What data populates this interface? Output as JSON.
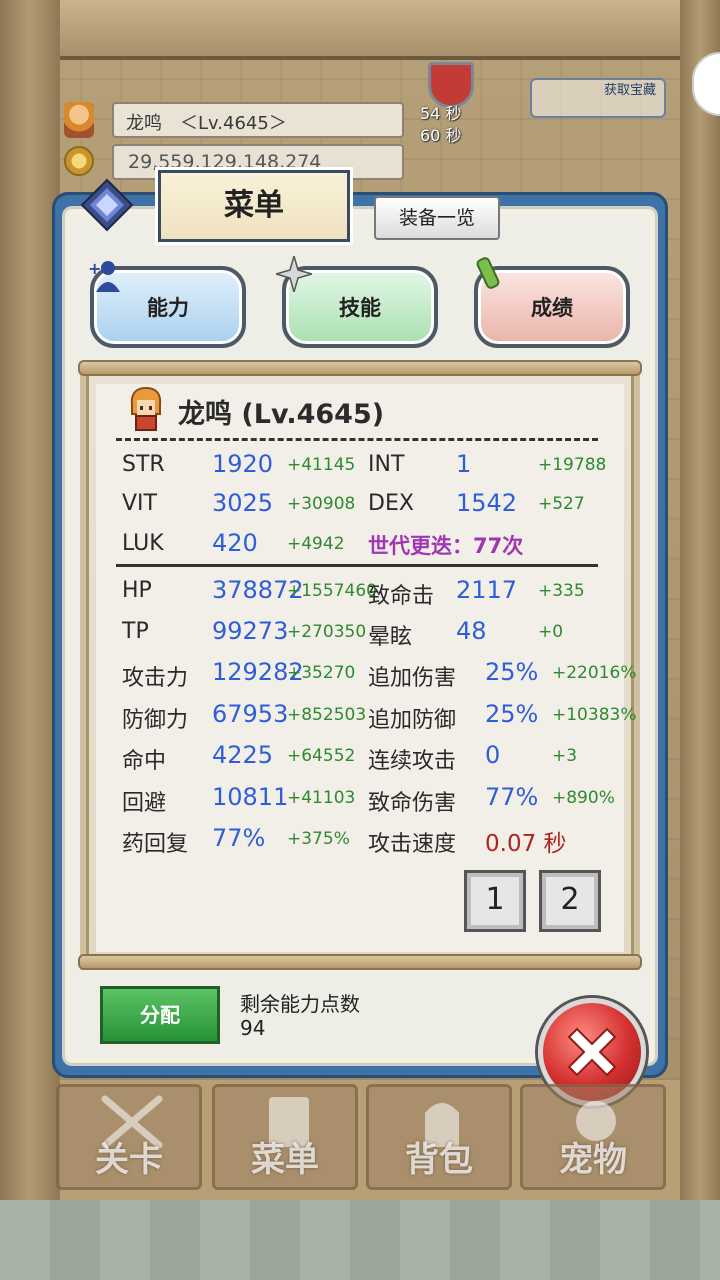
{
  "hud": {
    "player_label": "龙鸣　＜Lv.4645＞",
    "gold": "29,559,129,148,274",
    "timer1": "54 秒",
    "timer2": "60 秒",
    "bonus_label": "获取宝藏"
  },
  "menu": {
    "title": "菜单",
    "equip_list": "装备一览",
    "tabs": [
      "能力",
      "技能",
      "成绩"
    ]
  },
  "character": {
    "name": "龙鸣 (Lv.4645)"
  },
  "base_stats": [
    {
      "label": "STR",
      "value": "1920",
      "bonus": "+41145"
    },
    {
      "label": "INT",
      "value": "1",
      "bonus": "+19788"
    },
    {
      "label": "VIT",
      "value": "3025",
      "bonus": "+30908"
    },
    {
      "label": "DEX",
      "value": "1542",
      "bonus": "+527"
    },
    {
      "label": "LUK",
      "value": "420",
      "bonus": "+4942"
    }
  ],
  "generation": "世代更迭：77次",
  "combat_left": [
    {
      "label": "HP",
      "value": "378872",
      "bonus": "+1557460"
    },
    {
      "label": "TP",
      "value": "99273",
      "bonus": "+270350"
    },
    {
      "label": "攻击力",
      "value": "129282",
      "bonus": "+35270"
    },
    {
      "label": "防御力",
      "value": "67953",
      "bonus": "+852503"
    },
    {
      "label": "命中",
      "value": "4225",
      "bonus": "+64552"
    },
    {
      "label": "回避",
      "value": "10811",
      "bonus": "+41103"
    },
    {
      "label": "药回复",
      "value": "77%",
      "bonus": "+375%"
    }
  ],
  "combat_right": [
    {
      "label": "致命击",
      "value": "2117",
      "bonus": "+335"
    },
    {
      "label": "晕眩",
      "value": "48",
      "bonus": "+0"
    },
    {
      "label": "追加伤害",
      "value": "25%",
      "bonus": "+22016%"
    },
    {
      "label": "追加防御",
      "value": "25%",
      "bonus": "+10383%"
    },
    {
      "label": "连续攻击",
      "value": "0",
      "bonus": "+3"
    },
    {
      "label": "致命伤害",
      "value": "77%",
      "bonus": "+890%"
    },
    {
      "label": "攻击速度",
      "value": "0.07 秒",
      "bonus": ""
    }
  ],
  "pages": [
    "1",
    "2"
  ],
  "assign": {
    "button": "分配",
    "remaining_label": "剩余能力点数",
    "remaining_value": "94"
  },
  "nav": [
    "关卡",
    "菜单",
    "背包",
    "宠物"
  ],
  "colors": {
    "value_blue": "#2f5ed8",
    "bonus_green": "#2f8a2f",
    "generation_purple": "#a036b4",
    "speed_red": "#b22222",
    "assign_green": "#279336",
    "close_red": "#d32f2f"
  }
}
